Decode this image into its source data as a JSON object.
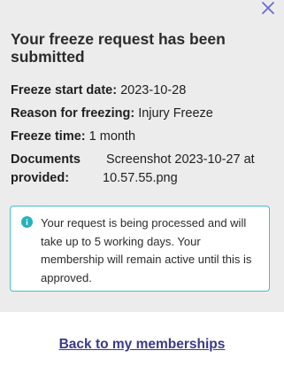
{
  "dialog": {
    "title": "Your freeze request has been submitted",
    "close_icon": "close-icon"
  },
  "details": {
    "freeze_start_label": "Freeze start date:",
    "freeze_start_value": "2023-10-28",
    "reason_label": "Reason for freezing:",
    "reason_value": "Injury Freeze",
    "freeze_time_label": "Freeze time:",
    "freeze_time_value": "1 month",
    "documents_label": "Documents provided:",
    "documents_value": "Screenshot 2023-10-27 at 10.57.55.png"
  },
  "notice": {
    "icon": "info-icon",
    "message": "Your request is being processed and will take up to 5 working days. Your membership will remain active until this is approved."
  },
  "footer": {
    "back_link": "Back to my memberships"
  },
  "colors": {
    "panel_bg": "#ececec",
    "accent_teal": "#3ec3c9",
    "link": "#3a3a8c",
    "close_icon": "#6b6bd6"
  }
}
